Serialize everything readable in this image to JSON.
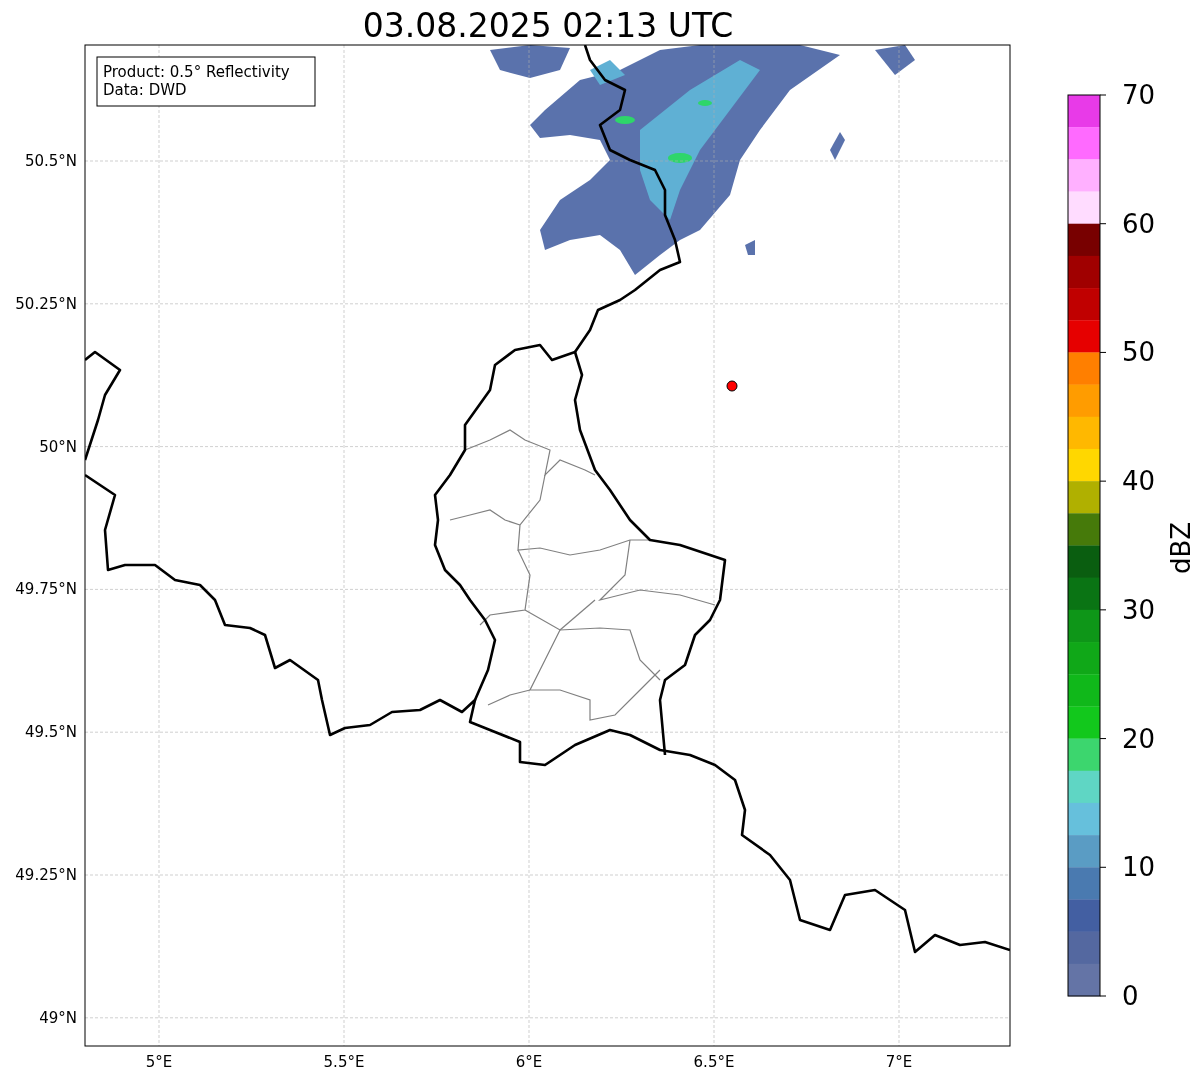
{
  "title": "03.08.2025 02:13 UTC",
  "info_box": {
    "lines": [
      "Product: 0.5° Reflectivity",
      "Data: DWD"
    ]
  },
  "map": {
    "x_ticks": [
      "5°E",
      "5.5°E",
      "6°E",
      "6.5°E",
      "7°E"
    ],
    "y_ticks": [
      "50.5°N",
      "50.25°N",
      "50°N",
      "49.75°N",
      "49.5°N",
      "49.25°N",
      "49°N"
    ]
  },
  "colorbar": {
    "label": "dBZ",
    "ticks": [
      "70",
      "60",
      "50",
      "40",
      "30",
      "20",
      "10",
      "0"
    ],
    "bins": [
      {
        "color": "#e83ae8"
      },
      {
        "color": "#ff6aff"
      },
      {
        "color": "#ffb0ff"
      },
      {
        "color": "#ffdcff"
      },
      {
        "color": "#780000"
      },
      {
        "color": "#a00000"
      },
      {
        "color": "#c00000"
      },
      {
        "color": "#e60000"
      },
      {
        "color": "#ff7f00"
      },
      {
        "color": "#ff9c00"
      },
      {
        "color": "#ffb800"
      },
      {
        "color": "#ffd700"
      },
      {
        "color": "#b0b000"
      },
      {
        "color": "#467a0a"
      },
      {
        "color": "#0a5e10"
      },
      {
        "color": "#0a7414"
      },
      {
        "color": "#0e9618"
      },
      {
        "color": "#10a818"
      },
      {
        "color": "#10b81a"
      },
      {
        "color": "#12c81c"
      },
      {
        "color": "#3cd66e"
      },
      {
        "color": "#5fd6c4"
      },
      {
        "color": "#66c0dc"
      },
      {
        "color": "#5a9cc4"
      },
      {
        "color": "#4a7ab0"
      },
      {
        "color": "#435fa2"
      },
      {
        "color": "#5468a0"
      },
      {
        "color": "#6474a6"
      }
    ]
  }
}
